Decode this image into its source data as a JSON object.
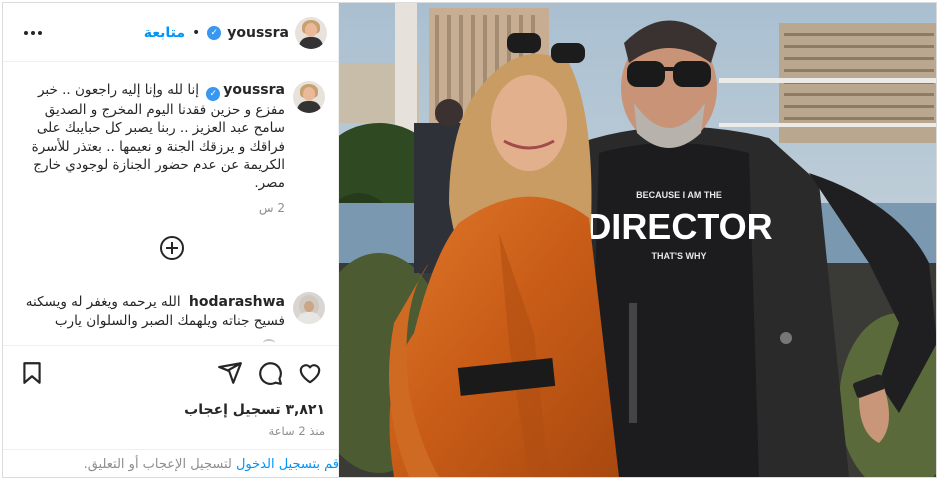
{
  "header": {
    "username": "youssra",
    "verified_mark": "✓",
    "separator": "•",
    "follow_label": "متابعة",
    "more_icon": "more-horizontal-icon"
  },
  "caption": {
    "username": "youssra",
    "text": "إنا لله وإنا إليه راجعون .. خبر مفزع و حزين فقدنا اليوم المخرج و الصديق سامح عبد العزيز .. ربنا يصبر كل حبايبك على فراقك و يرزقك الجنة و نعيمها .. بعتذر للأسرة الكريمة عن عدم حضور الجنازة لوجودي خارج مصر.",
    "time_ago": "2 س"
  },
  "load_more_icon": "plus-circle-icon",
  "comment": {
    "username": "hodarashwa",
    "text": "الله يرحمه ويغفر له ويسكنه فسيح جناته ويلهمك الصبر والسلوان يارب"
  },
  "actions": {
    "like_icon": "heart-icon",
    "comment_icon": "comment-icon",
    "share_icon": "share-icon",
    "save_icon": "bookmark-icon"
  },
  "likes_text": "٣,٨٢١ تسجيل إعجاب",
  "posted_time": "منذ 2 ساعة",
  "login_prompt": {
    "link": "قم بتسجيل الدخول",
    "rest": " لتسجيل الإعجاب أو التعليق."
  },
  "photo": {
    "shirt_line1": "BECAUSE I AM THE",
    "shirt_line2": "DIRECTOR",
    "shirt_line3": "THAT'S WHY"
  },
  "colors": {
    "accent": "#0095f6",
    "verified": "#3897f0",
    "muted": "#8e8e8e"
  }
}
